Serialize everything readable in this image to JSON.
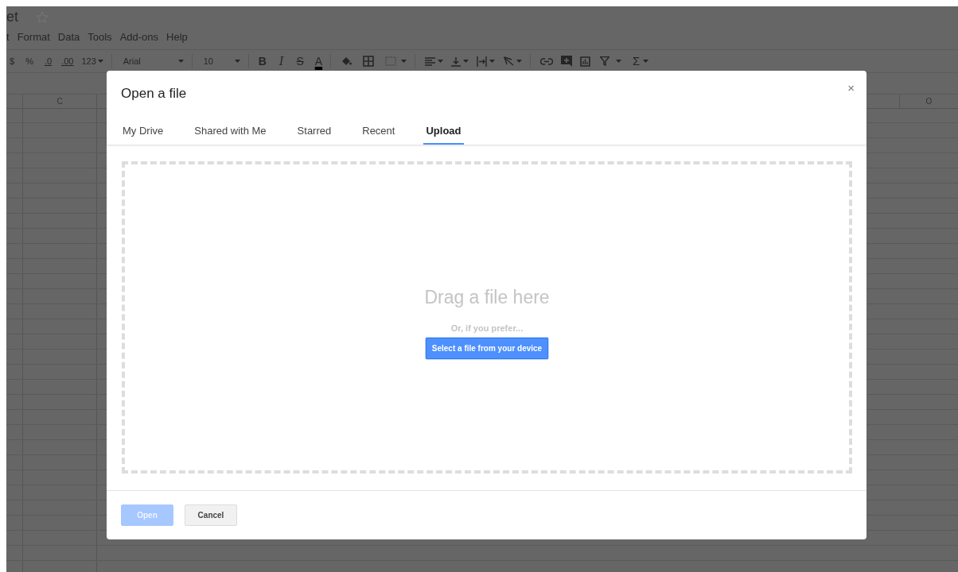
{
  "app": {
    "title": "et",
    "starred": false,
    "menu": [
      "t",
      "Format",
      "Data",
      "Tools",
      "Add-ons",
      "Help"
    ],
    "toolbar": {
      "currency": "$",
      "percent": "%",
      "decrease_decimals": ".0",
      "increase_decimals": ".00",
      "number_format": "123",
      "font": "Arial",
      "font_size": "10",
      "bold": "B",
      "italic": "I",
      "strikethrough": "S",
      "text_color": "A",
      "functions": "Σ"
    },
    "column_headers": [
      {
        "label": "C"
      },
      {
        "label": "O"
      }
    ]
  },
  "dialog": {
    "title": "Open a file",
    "close": "×",
    "tabs": [
      {
        "label": "My Drive",
        "selected": false
      },
      {
        "label": "Shared with Me",
        "selected": false
      },
      {
        "label": "Starred",
        "selected": false
      },
      {
        "label": "Recent",
        "selected": false
      },
      {
        "label": "Upload",
        "selected": true
      }
    ],
    "drop_zone": {
      "heading": "Drag a file here",
      "subheading": "Or, if you prefer...",
      "button": "Select a file from your device"
    },
    "buttons": [
      {
        "label": "Open",
        "kind": "primary",
        "disabled": true
      },
      {
        "label": "Cancel",
        "kind": "secondary",
        "disabled": false
      }
    ]
  }
}
